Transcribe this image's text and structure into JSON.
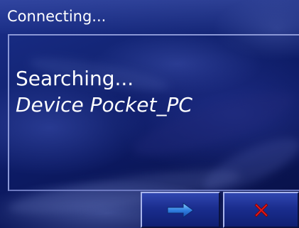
{
  "window": {
    "title": "Connecting..."
  },
  "main": {
    "status": "Searching...",
    "device": "Device Pocket_PC"
  },
  "buttons": {
    "next_icon": "right-arrow-icon",
    "cancel_icon": "red-x-icon"
  },
  "colors": {
    "text": "#ffffff",
    "arrow": "#2f7fe0",
    "cancel": "#e01818"
  }
}
